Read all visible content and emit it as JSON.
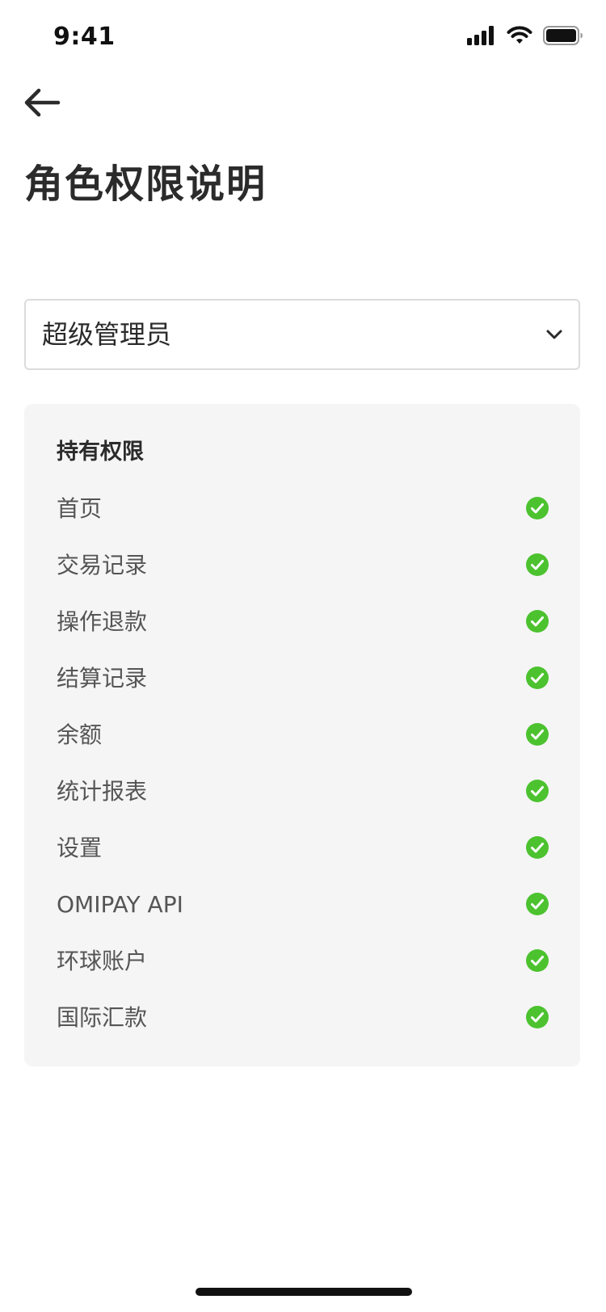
{
  "status_bar": {
    "time": "9:41"
  },
  "header": {
    "back_icon": "arrow-left-icon",
    "title": "角色权限说明"
  },
  "role_select": {
    "value": "超级管理员",
    "icon": "chevron-down-icon"
  },
  "permissions": {
    "title": "持有权限",
    "check_color": "#4cc22f",
    "items": [
      {
        "label": "首页",
        "granted": true
      },
      {
        "label": "交易记录",
        "granted": true
      },
      {
        "label": "操作退款",
        "granted": true
      },
      {
        "label": "结算记录",
        "granted": true
      },
      {
        "label": "余额",
        "granted": true
      },
      {
        "label": "统计报表",
        "granted": true
      },
      {
        "label": "设置",
        "granted": true
      },
      {
        "label": "OMIPAY API",
        "granted": true
      },
      {
        "label": "环球账户",
        "granted": true
      },
      {
        "label": "国际汇款",
        "granted": true
      }
    ]
  }
}
